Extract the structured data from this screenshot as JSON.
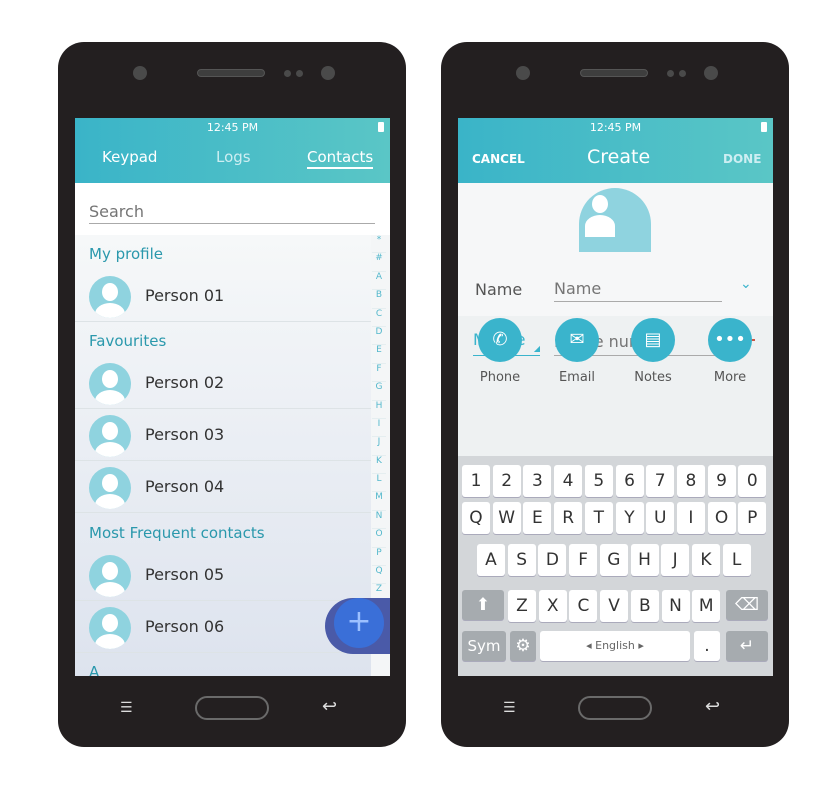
{
  "status": {
    "time": "12:45 PM"
  },
  "left": {
    "tabs": [
      "Keypad",
      "Logs",
      "Contacts"
    ],
    "active_tab": "Contacts",
    "search_placeholder": "Search",
    "sections": {
      "profile": "My profile",
      "favourites": "Favourites",
      "frequent": "Most Frequent contacts",
      "a": "A"
    },
    "contacts": [
      "Person 01",
      "Person 02",
      "Person 03",
      "Person 04",
      "Person 05",
      "Person 06"
    ],
    "index": [
      "*",
      "#",
      "A",
      "B",
      "C",
      "D",
      "E",
      "F",
      "G",
      "H",
      "I",
      "J",
      "K",
      "L",
      "M",
      "N",
      "O",
      "P",
      "Q",
      "Z"
    ],
    "fab_icon": "plus-icon"
  },
  "right": {
    "cancel": "CANCEL",
    "title": "Create",
    "done": "DONE",
    "name_label": "Name",
    "name_placeholder": "Name",
    "phone_type": "Mobile",
    "phone_placeholder": "Phone number",
    "actions": [
      "Phone",
      "Email",
      "Notes",
      "More"
    ],
    "keyboard": {
      "row1": [
        "1",
        "2",
        "3",
        "4",
        "5",
        "6",
        "7",
        "8",
        "9",
        "0"
      ],
      "row2": [
        "Q",
        "W",
        "E",
        "R",
        "T",
        "Y",
        "U",
        "I",
        "O",
        "P"
      ],
      "row3": [
        "A",
        "S",
        "D",
        "F",
        "G",
        "H",
        "J",
        "K",
        "L"
      ],
      "row4": [
        "Z",
        "X",
        "C",
        "V",
        "B",
        "N",
        "M"
      ],
      "sym": "Sym",
      "language": "English",
      "punct": ".",
      "punct_hint": "**?",
      "settings_hint": "..."
    }
  },
  "colors": {
    "accent": "#3ab4c8",
    "header_end": "#5ac6c6",
    "fab": "#3a6fd8"
  }
}
